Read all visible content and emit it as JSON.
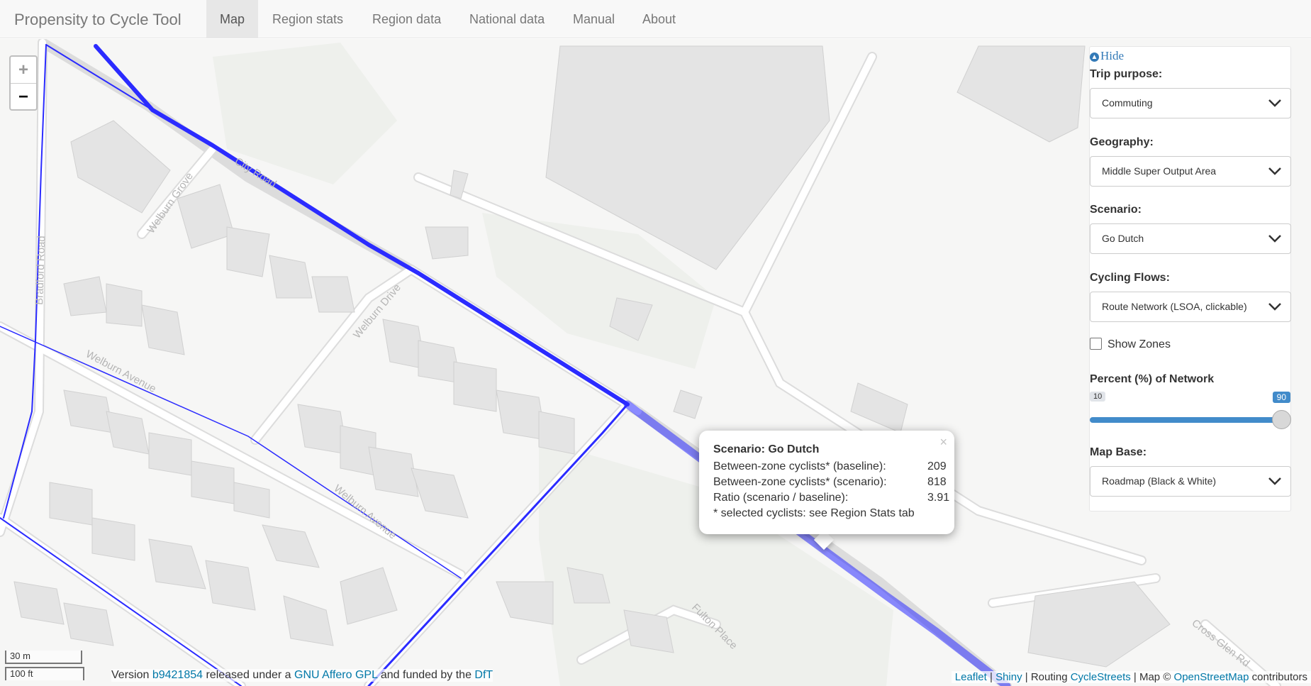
{
  "navbar": {
    "brand": "Propensity to Cycle Tool",
    "tabs": [
      {
        "label": "Map",
        "active": true
      },
      {
        "label": "Region stats",
        "active": false
      },
      {
        "label": "Region data",
        "active": false
      },
      {
        "label": "National data",
        "active": false
      },
      {
        "label": "Manual",
        "active": false
      },
      {
        "label": "About",
        "active": false
      }
    ]
  },
  "map": {
    "zoom_in": "+",
    "zoom_out": "−",
    "street_labels": [
      "Welburn Grove",
      "Welburn Drive",
      "Welburn Avenue",
      "Welburn Avenue",
      "Fulton Place",
      "Cross Glen Rd",
      "City Road",
      "Bradford Road"
    ],
    "scale": {
      "metric": "30 m",
      "imperial": "100 ft"
    },
    "version": {
      "prefix": "Version",
      "commit": "b9421854",
      "middle": "released under a",
      "license": "GNU Affero GPL",
      "suffix": "and funded by the",
      "funder": "DfT"
    },
    "attribution": {
      "leaflet": "Leaflet",
      "sep1": "|",
      "shiny": "Shiny",
      "routing_prefix": "| Routing",
      "routing": "CycleStreets",
      "map_prefix": "| Map ©",
      "osm": "OpenStreetMap",
      "contributors": "contributors"
    },
    "route_color": "#2b2bff"
  },
  "popup": {
    "close": "×",
    "title": "Scenario: Go Dutch",
    "rows": [
      {
        "label": "Between-zone cyclists* (baseline):",
        "value": "209"
      },
      {
        "label": "Between-zone cyclists* (scenario):",
        "value": "818"
      },
      {
        "label": "Ratio (scenario / baseline):",
        "value": "3.91"
      }
    ],
    "footnote": "* selected cyclists: see Region Stats tab"
  },
  "panel": {
    "hide_label": "Hide",
    "trip_purpose": {
      "label": "Trip purpose:",
      "value": "Commuting"
    },
    "geography": {
      "label": "Geography:",
      "value": "Middle Super Output Area"
    },
    "scenario": {
      "label": "Scenario:",
      "value": "Go Dutch"
    },
    "cycling_flows": {
      "label": "Cycling Flows:",
      "value": "Route Network (LSOA, clickable)"
    },
    "show_zones": {
      "label": "Show Zones",
      "checked": false
    },
    "percent_network": {
      "label": "Percent (%) of Network",
      "min": "10",
      "value": "90"
    },
    "map_base": {
      "label": "Map Base:",
      "value": "Roadmap (Black & White)"
    }
  }
}
